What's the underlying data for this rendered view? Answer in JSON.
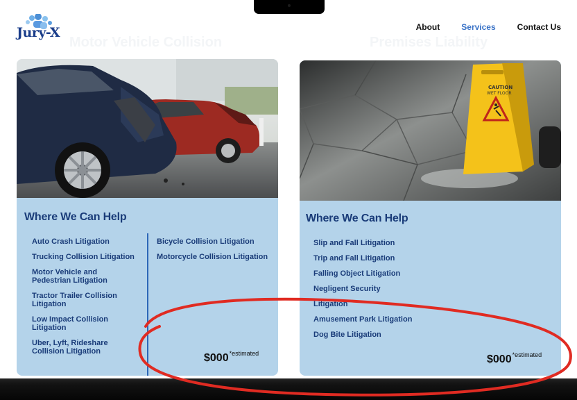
{
  "logo": {
    "text": "Jury-X"
  },
  "nav": {
    "items": [
      {
        "label": "About"
      },
      {
        "label": "Services",
        "active": true
      },
      {
        "label": "Contact Us"
      }
    ]
  },
  "sections": [
    {
      "title": "Motor Vehicle Collision",
      "help_heading": "Where We Can Help",
      "col1": [
        "Auto Crash Litigation",
        "Trucking Collision Litigation",
        "Motor Vehicle and Pedestrian Litigation",
        "Tractor Trailer Collision Litigation",
        "Low Impact Collision Litigation",
        "Uber, Lyft, Rideshare Collision Litigation"
      ],
      "col2": [
        "Bicycle Collision Litigation",
        "Motorcycle Collision Litigation"
      ],
      "price": "$000",
      "price_note": "*estimated"
    },
    {
      "title": "Premises Liability",
      "help_heading": "Where We Can Help",
      "items": [
        "Slip and Fall Litigation",
        "Trip and Fall Litigation",
        "Falling Object Litigation",
        "Negligent Security",
        "Litigation",
        "Amusement Park Litigation",
        "Dog Bite Litigation"
      ],
      "price": "$000",
      "price_note": "*estimated",
      "sign_text": {
        "line1": "CAUTION",
        "line2": "WET FLOOR"
      }
    }
  ],
  "colors": {
    "accent": "#3a73c7",
    "card_bg": "#b4d3ea",
    "heading": "#1a3c79",
    "annotation": "#e02b22"
  }
}
